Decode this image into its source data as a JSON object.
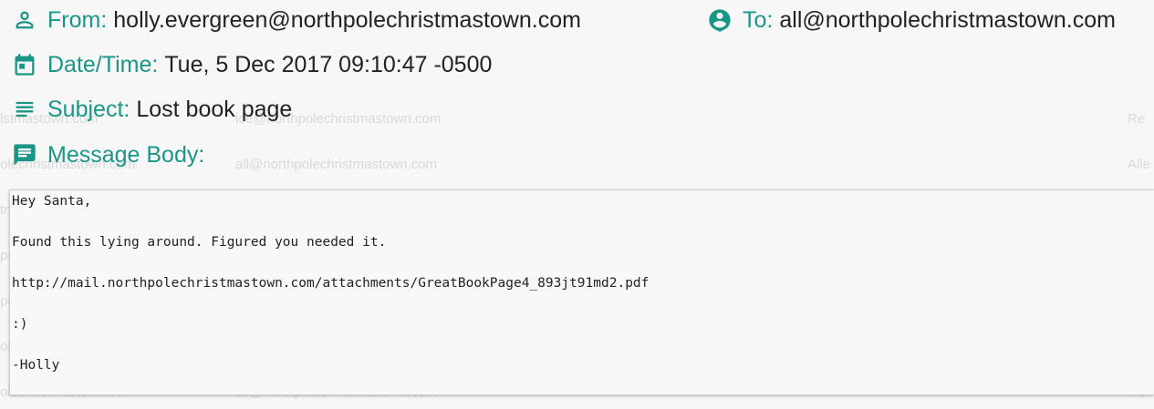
{
  "header": {
    "from_label": "From:",
    "from_value": "holly.evergreen@northpolechristmastown.com",
    "to_label": "To:",
    "to_value": "all@northpolechristmastown.com",
    "date_label": "Date/Time:",
    "date_value": "Tue, 5 Dec 2017 09:10:47 -0500",
    "subject_label": "Subject:",
    "subject_value": "Lost book page",
    "body_label": "Message Body:"
  },
  "message": {
    "lines": [
      "Hey Santa,",
      "Found this lying around. Figured you needed it.",
      "http://mail.northpolechristmastown.com/attachments/GreatBookPage4_893jt91md2.pdf",
      ":)",
      "-Holly"
    ]
  },
  "icons": {
    "from": "person-icon",
    "to": "account-circle-icon",
    "date": "calendar-icon",
    "subject": "subject-lines-icon",
    "body": "message-icon"
  },
  "colors": {
    "accent": "#1a9688",
    "text": "#222222",
    "background": "#f7f7f7"
  }
}
